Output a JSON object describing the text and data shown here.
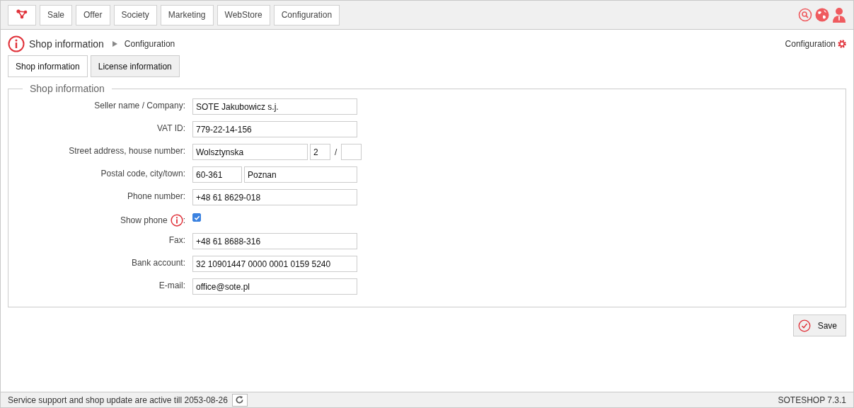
{
  "menu": [
    {
      "label": "Sale",
      "selected": false
    },
    {
      "label": "Offer",
      "selected": false
    },
    {
      "label": "Society",
      "selected": false
    },
    {
      "label": "Marketing",
      "selected": false
    },
    {
      "label": "WebStore",
      "selected": false
    },
    {
      "label": "Configuration",
      "selected": false
    }
  ],
  "breadcrumb": {
    "title": "Shop information",
    "parent": "Configuration"
  },
  "config_link": "Configuration",
  "tabs": [
    {
      "label": "Shop information",
      "selected": true
    },
    {
      "label": "License information",
      "selected": false
    }
  ],
  "fieldset": {
    "legend": "Shop information",
    "rows": [
      {
        "kind": "text",
        "label": "Seller name / Company:",
        "value": "SOTE Jakubowicz s.j."
      },
      {
        "kind": "text",
        "label": "VAT ID:",
        "value": "779-22-14-156"
      },
      {
        "kind": "address",
        "label": "Street address, house number:",
        "street": "Wolsztynska",
        "house_number": "2",
        "separator": "/"
      },
      {
        "kind": "postal",
        "label": "Postal code, city/town:",
        "postal_code": "60-361",
        "city": "Poznan"
      },
      {
        "kind": "text",
        "label": "Phone number:",
        "value": "+48 61 8629-018"
      },
      {
        "kind": "checkbox",
        "label": "Show phone",
        "suffix": ":",
        "checked": true
      },
      {
        "kind": "text",
        "label": "Fax:",
        "value": "+48 61 8688-316"
      },
      {
        "kind": "text",
        "label": "Bank account:",
        "value": "32 10901447 0000 0001 0159 5240"
      },
      {
        "kind": "text",
        "label": "E-mail:",
        "value": "office@sote.pl"
      }
    ]
  },
  "save_button": "Save",
  "status_bar": {
    "message": "Service support and shop update are active till 2053-08-26",
    "version": "SOTESHOP 7.3.1"
  }
}
